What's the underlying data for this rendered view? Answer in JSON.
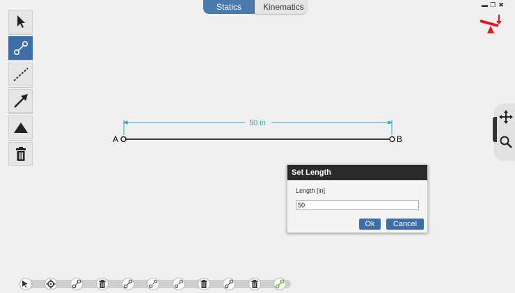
{
  "tabs": [
    {
      "label": "Statics",
      "active": true
    },
    {
      "label": "Kinematics",
      "active": false
    }
  ],
  "window_controls": [
    "minimize-icon",
    "restore-icon",
    "close-icon"
  ],
  "toolbar": {
    "tools": [
      {
        "name": "select-tool",
        "icon": "cursor-arrow-icon",
        "selected": false
      },
      {
        "name": "member-tool",
        "icon": "member-link-icon",
        "selected": true
      },
      {
        "name": "dashed-member-tool",
        "icon": "dashed-line-icon",
        "selected": false
      },
      {
        "name": "force-tool",
        "icon": "arrow-icon",
        "selected": false
      },
      {
        "name": "support-tool",
        "icon": "triangle-icon",
        "selected": false
      },
      {
        "name": "delete-tool",
        "icon": "trash-icon",
        "selected": false
      }
    ]
  },
  "canvas": {
    "point_a_label": "A",
    "point_b_label": "B",
    "dimension_label": "50 in",
    "dimension_color": "#2aa6c7",
    "member_color": "#000000"
  },
  "side_controls": [
    {
      "icon": "move-arrows-icon"
    },
    {
      "icon": "magnifier-icon"
    }
  ],
  "dialog": {
    "title": "Set Length",
    "field_label": "Length [in]",
    "value": "50",
    "ok_label": "Ok",
    "cancel_label": "Cancel"
  },
  "history": [
    {
      "icon": "pointer-icon"
    },
    {
      "icon": "gear-icon"
    },
    {
      "icon": "member-link-icon"
    },
    {
      "icon": "trash-icon"
    },
    {
      "icon": "member-link-icon"
    },
    {
      "icon": "dashed-member-icon"
    },
    {
      "icon": "dashed-member-icon"
    },
    {
      "icon": "trash-icon"
    },
    {
      "icon": "member-link-icon"
    },
    {
      "icon": "trash-icon"
    },
    {
      "icon": "member-link-active-icon"
    }
  ],
  "colors": {
    "accent": "#3d6ea8",
    "logo_red": "#e8161b"
  }
}
